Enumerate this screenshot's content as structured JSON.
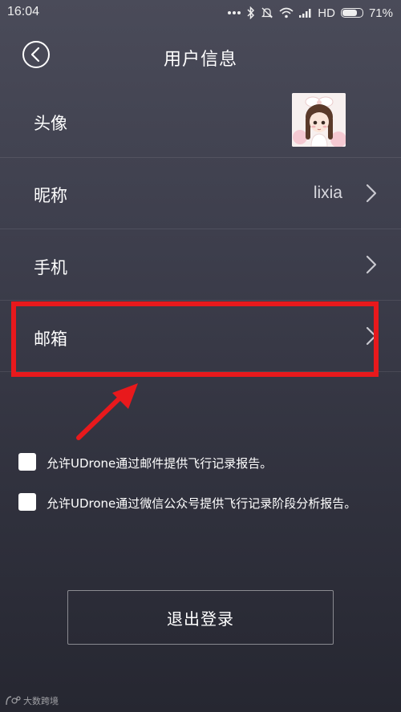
{
  "status_bar": {
    "time": "16:04",
    "network": "HD",
    "battery": "71%"
  },
  "header": {
    "title": "用户信息"
  },
  "rows": [
    {
      "label": "头像"
    },
    {
      "label": "昵称",
      "value": "lixia"
    },
    {
      "label": "手机"
    },
    {
      "label": "邮箱"
    }
  ],
  "checkboxes": [
    {
      "label": "允许UDrone通过邮件提供飞行记录报告。"
    },
    {
      "label": "允许UDrone通过微信公众号提供飞行记录阶段分析报告。"
    }
  ],
  "logout": {
    "label": "退出登录"
  },
  "watermark": {
    "text": "大数跨境"
  },
  "colors": {
    "highlight": "#e8191c",
    "background_top": "#4a4b59",
    "background_bottom": "#262731"
  },
  "icons": {
    "back": "back-circle-icon",
    "chevron": "chevron-right-icon"
  }
}
